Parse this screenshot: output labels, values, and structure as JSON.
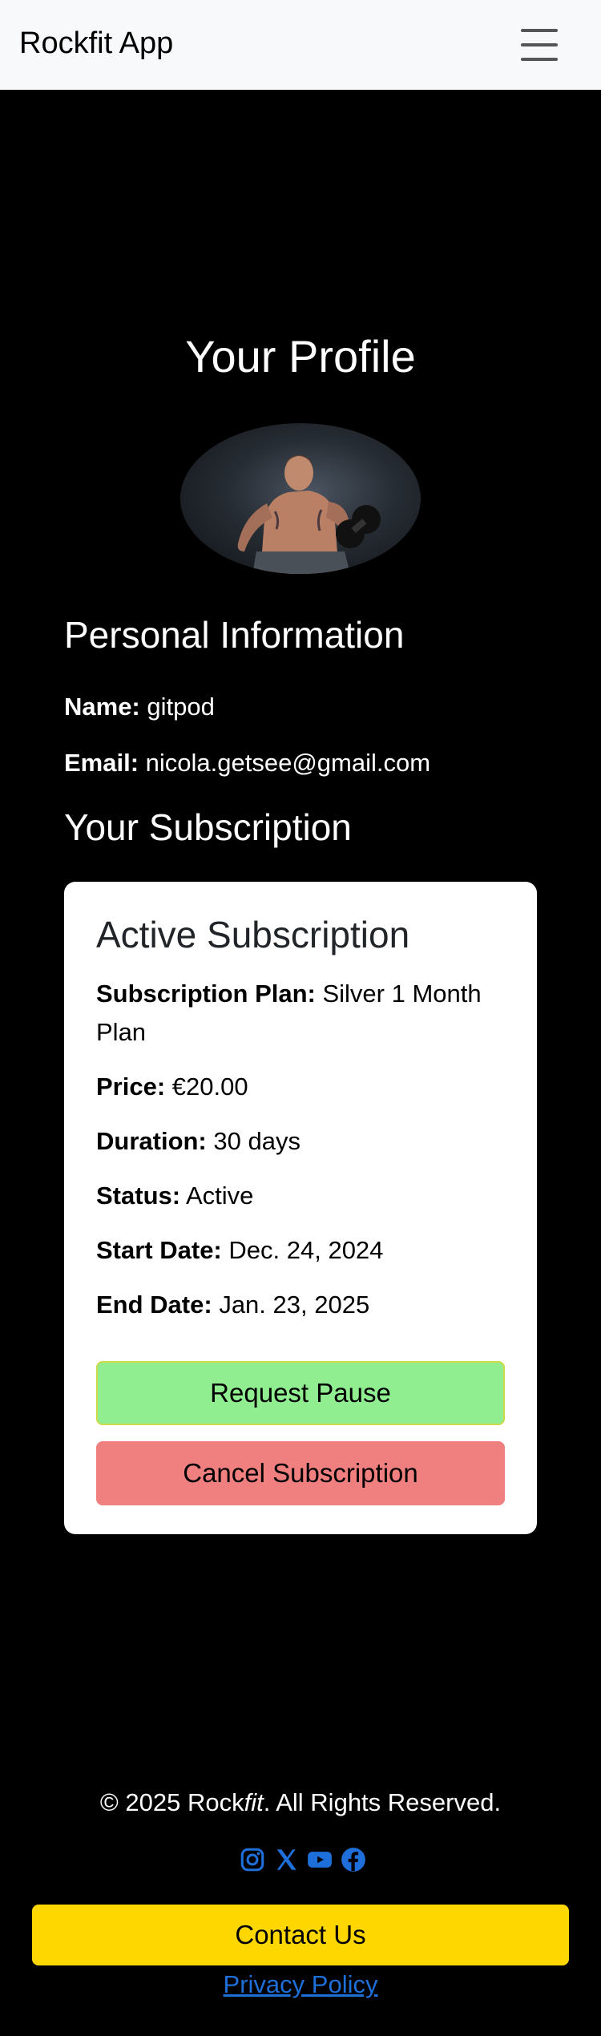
{
  "navbar": {
    "brand": "Rockfit App",
    "menu_icon": "hamburger-menu-icon"
  },
  "profile": {
    "title": "Your Profile",
    "avatar_image": "profile-photo-muscular-man-with-dumbbell"
  },
  "personal": {
    "heading": "Personal Information",
    "name_label": "Name:",
    "name_value": "gitpod",
    "email_label": "Email:",
    "email_value": "nicola.getsee@gmail.com"
  },
  "subscription": {
    "heading": "Your Subscription",
    "card_title": "Active Subscription",
    "plan_label": "Subscription Plan:",
    "plan_value": "Silver 1 Month Plan",
    "price_label": "Price:",
    "price_value": "€20.00",
    "duration_label": "Duration:",
    "duration_value": "30 days",
    "status_label": "Status:",
    "status_value": "Active",
    "start_label": "Start Date:",
    "start_value": "Dec. 24, 2024",
    "end_label": "End Date:",
    "end_value": "Jan. 23, 2025",
    "pause_button": "Request Pause",
    "cancel_button": "Cancel Subscription",
    "colors": {
      "pause": "#90ee90",
      "cancel": "#f08080"
    }
  },
  "footer": {
    "copyright_prefix": "© 2025 Rock",
    "copyright_brand_italic": "fit",
    "copyright_suffix": ". All Rights Reserved.",
    "social_icons": [
      "instagram-icon",
      "x-twitter-icon",
      "youtube-icon",
      "facebook-icon"
    ],
    "social_color": "#1e6fd9",
    "contact_button": "Contact Us",
    "contact_color": "#ffd700",
    "privacy_link": "Privacy Policy"
  }
}
